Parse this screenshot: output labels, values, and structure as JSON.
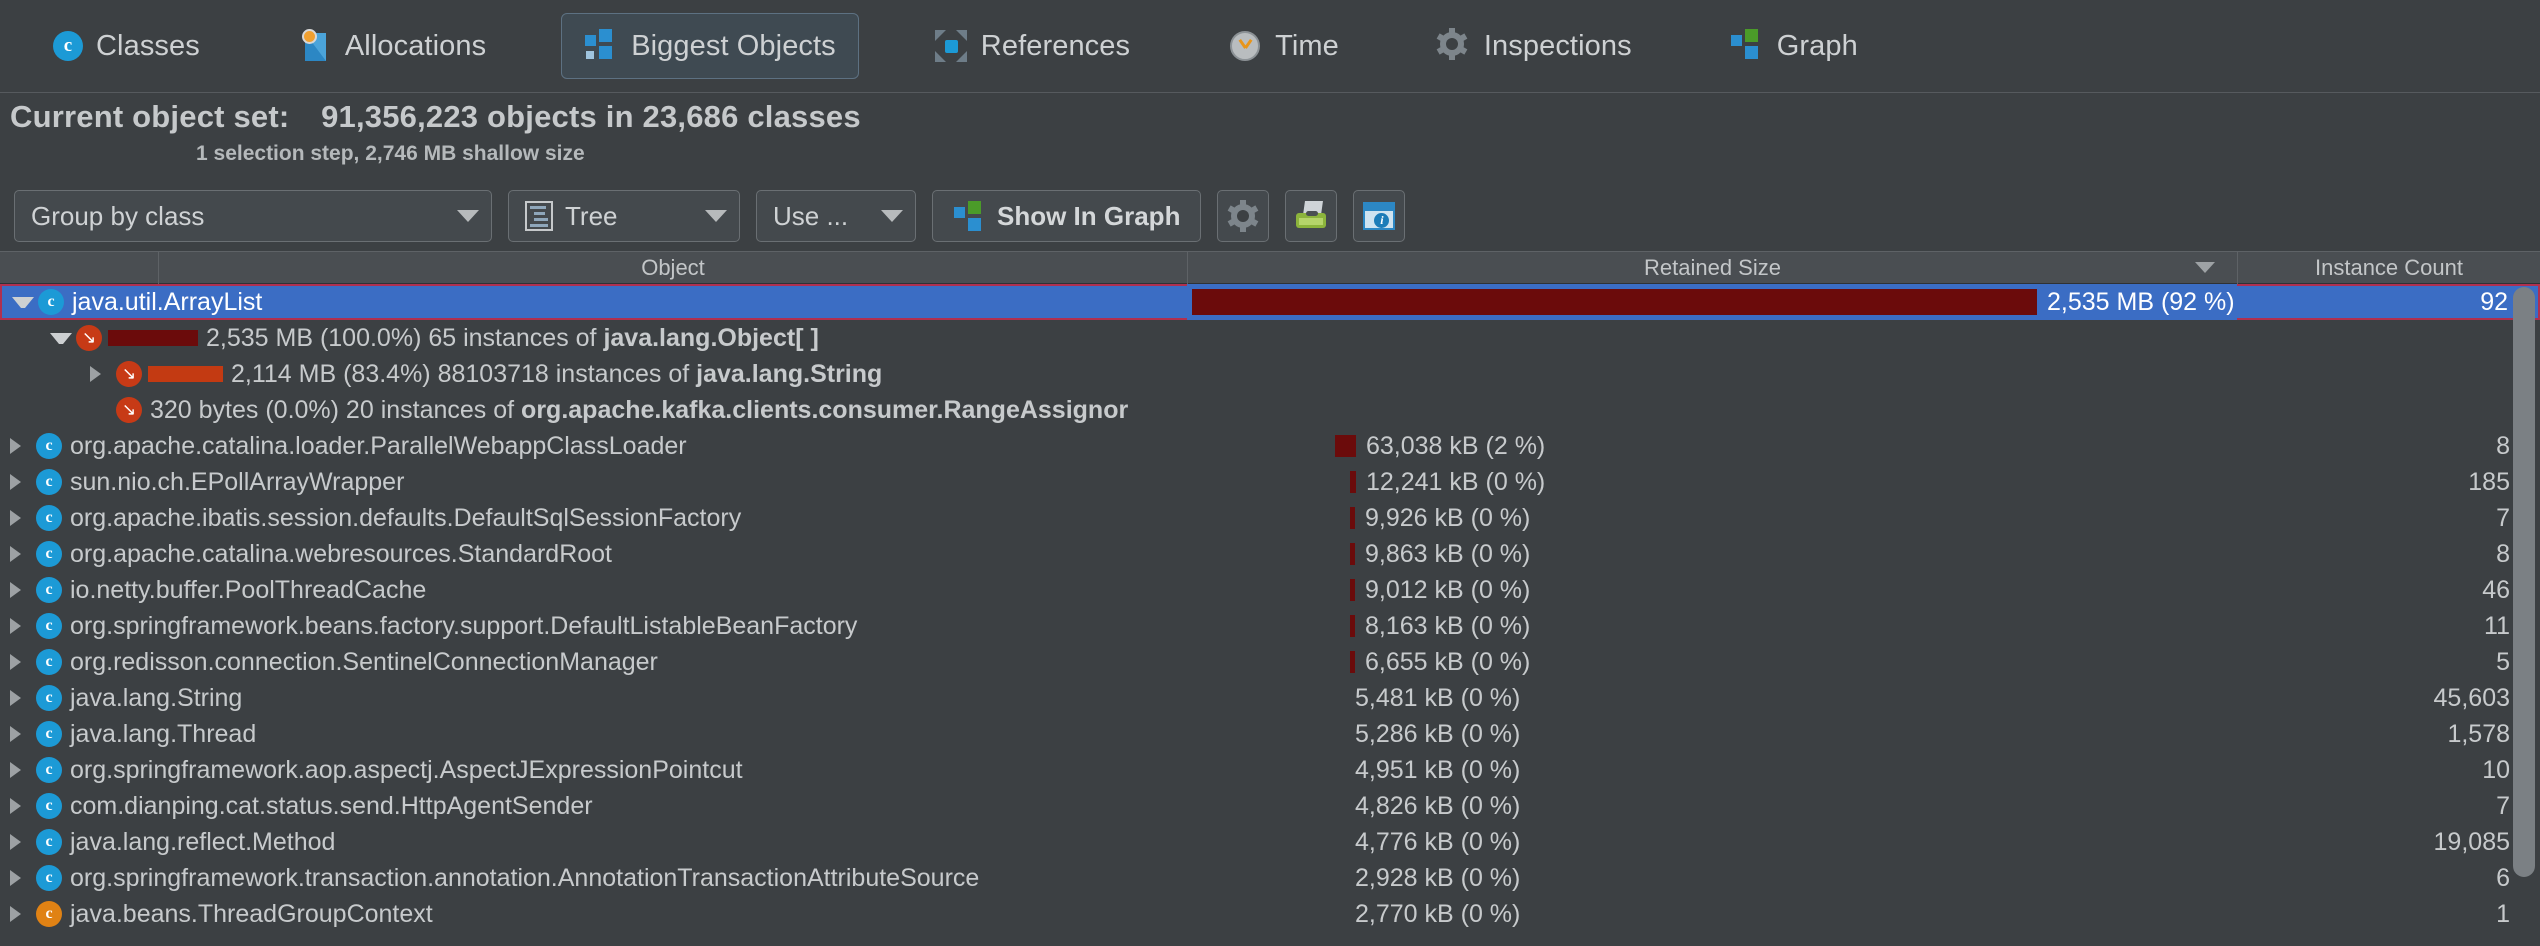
{
  "tabs": [
    {
      "label": "Classes",
      "icon": "class-circle-icon",
      "selected": false
    },
    {
      "label": "Allocations",
      "icon": "allocations-icon",
      "selected": false
    },
    {
      "label": "Biggest Objects",
      "icon": "biggest-objects-icon",
      "selected": true
    },
    {
      "label": "References",
      "icon": "references-icon",
      "selected": false
    },
    {
      "label": "Time",
      "icon": "clock-icon",
      "selected": false
    },
    {
      "label": "Inspections",
      "icon": "gear-icon",
      "selected": false
    },
    {
      "label": "Graph",
      "icon": "graph-icon",
      "selected": false
    }
  ],
  "object_set": {
    "label": "Current object set:",
    "summary": "91,356,223 objects in 23,686 classes",
    "detail": "1 selection step, 2,746 MB shallow size",
    "objects_count": "91,356,223",
    "classes_count": "23,686",
    "selection_steps": "1",
    "shallow_size": "2,746 MB"
  },
  "toolbar": {
    "group_by": "Group by class",
    "view_mode": "Tree",
    "use_menu": "Use ...",
    "show_in_graph": "Show In Graph",
    "settings_icon": "gear-icon",
    "export_icon": "typewriter-printer-icon",
    "info_icon": "info-window-icon"
  },
  "table": {
    "columns": [
      "",
      "Object",
      "Retained Size",
      "Instance Count"
    ],
    "sorted_column": "Retained Size",
    "rows": [
      {
        "kind": "class",
        "icon": "class-circle-icon",
        "icon_color": "#1c9ad6",
        "depth": 0,
        "twisty": "open",
        "selected": true,
        "name": "java.util.ArrayList",
        "retained_size": "2,535 MB (92 %)",
        "bar_pct": 92,
        "bar_color": "#6b0b0b",
        "instance_count": "92"
      },
      {
        "kind": "reference",
        "icon": "reference-arrow-icon",
        "icon_color": "#c73a16",
        "depth": 1,
        "twisty": "open",
        "selected": false,
        "name": "2,535 MB (100.0%) 65 instances of java.lang.Object[ ]",
        "size_text": "2,535 MB (100.0%)",
        "instances_text": "65 instances of",
        "class_name": "java.lang.Object[ ]",
        "mini_bar_pct": 100,
        "retained_size": "",
        "instance_count": ""
      },
      {
        "kind": "reference",
        "icon": "reference-arrow-icon",
        "icon_color": "#c73a16",
        "depth": 2,
        "twisty": "closed",
        "selected": false,
        "name": "2,114 MB (83.4%) 88103718 instances of java.lang.String",
        "size_text": "2,114 MB (83.4%)",
        "instances_text": "88103718 instances of",
        "class_name": "java.lang.String",
        "mini_bar_pct": 83.4,
        "retained_size": "",
        "instance_count": ""
      },
      {
        "kind": "reference",
        "icon": "reference-arrow-icon",
        "icon_color": "#c73a16",
        "depth": 2,
        "twisty": "none",
        "selected": false,
        "name": "320 bytes (0.0%) 20 instances of org.apache.kafka.clients.consumer.RangeAssignor",
        "size_text": "320 bytes (0.0%)",
        "instances_text": "20 instances of",
        "class_name": "org.apache.kafka.clients.consumer.RangeAssignor",
        "mini_bar_pct": 0,
        "retained_size": "",
        "instance_count": ""
      },
      {
        "kind": "class",
        "icon": "class-circle-icon",
        "icon_color": "#1c9ad6",
        "depth": 0,
        "twisty": "closed",
        "selected": false,
        "name": "org.apache.catalina.loader.ParallelWebappClassLoader",
        "retained_size": "63,038 kB (2 %)",
        "bar_pct": 2.3,
        "bar_color": "#6b0b0b",
        "instance_count": "8"
      },
      {
        "kind": "class",
        "icon": "class-circle-icon",
        "icon_color": "#1c9ad6",
        "depth": 0,
        "twisty": "closed",
        "selected": false,
        "name": "sun.nio.ch.EPollArrayWrapper",
        "retained_size": "12,241 kB (0 %)",
        "bar_pct": 0.45,
        "bar_color": "#6b0b0b",
        "instance_count": "185"
      },
      {
        "kind": "class",
        "icon": "class-circle-icon",
        "icon_color": "#1c9ad6",
        "depth": 0,
        "twisty": "closed",
        "selected": false,
        "name": "org.apache.ibatis.session.defaults.DefaultSqlSessionFactory",
        "retained_size": "9,926 kB (0 %)",
        "bar_pct": 0.36,
        "bar_color": "#6b0b0b",
        "instance_count": "7"
      },
      {
        "kind": "class",
        "icon": "class-circle-icon",
        "icon_color": "#1c9ad6",
        "depth": 0,
        "twisty": "closed",
        "selected": false,
        "name": "org.apache.catalina.webresources.StandardRoot",
        "retained_size": "9,863 kB (0 %)",
        "bar_pct": 0.36,
        "bar_color": "#6b0b0b",
        "instance_count": "8"
      },
      {
        "kind": "class",
        "icon": "class-circle-icon",
        "icon_color": "#1c9ad6",
        "depth": 0,
        "twisty": "closed",
        "selected": false,
        "name": "io.netty.buffer.PoolThreadCache",
        "retained_size": "9,012 kB (0 %)",
        "bar_pct": 0.33,
        "bar_color": "#6b0b0b",
        "instance_count": "46"
      },
      {
        "kind": "class",
        "icon": "class-circle-icon",
        "icon_color": "#1c9ad6",
        "depth": 0,
        "twisty": "closed",
        "selected": false,
        "name": "org.springframework.beans.factory.support.DefaultListableBeanFactory",
        "retained_size": "8,163 kB (0 %)",
        "bar_pct": 0.3,
        "bar_color": "#6b0b0b",
        "instance_count": "11"
      },
      {
        "kind": "class",
        "icon": "class-circle-icon",
        "icon_color": "#1c9ad6",
        "depth": 0,
        "twisty": "closed",
        "selected": false,
        "name": "org.redisson.connection.SentinelConnectionManager",
        "retained_size": "6,655 kB (0 %)",
        "bar_pct": 0.24,
        "bar_color": "#6b0b0b",
        "instance_count": "5"
      },
      {
        "kind": "class",
        "icon": "class-circle-icon",
        "icon_color": "#1c9ad6",
        "depth": 0,
        "twisty": "closed",
        "selected": false,
        "name": "java.lang.String",
        "retained_size": "5,481 kB (0 %)",
        "bar_pct": 0,
        "bar_color": "#6b0b0b",
        "instance_count": "45,603"
      },
      {
        "kind": "class",
        "icon": "class-circle-icon",
        "icon_color": "#1c9ad6",
        "depth": 0,
        "twisty": "closed",
        "selected": false,
        "name": "java.lang.Thread",
        "retained_size": "5,286 kB (0 %)",
        "bar_pct": 0,
        "bar_color": "#6b0b0b",
        "instance_count": "1,578"
      },
      {
        "kind": "class",
        "icon": "class-circle-icon",
        "icon_color": "#1c9ad6",
        "depth": 0,
        "twisty": "closed",
        "selected": false,
        "name": "org.springframework.aop.aspectj.AspectJExpressionPointcut",
        "retained_size": "4,951 kB (0 %)",
        "bar_pct": 0,
        "bar_color": "#6b0b0b",
        "instance_count": "10"
      },
      {
        "kind": "class",
        "icon": "class-circle-icon",
        "icon_color": "#1c9ad6",
        "depth": 0,
        "twisty": "closed",
        "selected": false,
        "name": "com.dianping.cat.status.send.HttpAgentSender",
        "retained_size": "4,826 kB (0 %)",
        "bar_pct": 0,
        "bar_color": "#6b0b0b",
        "instance_count": "7"
      },
      {
        "kind": "class",
        "icon": "class-circle-icon",
        "icon_color": "#1c9ad6",
        "depth": 0,
        "twisty": "closed",
        "selected": false,
        "name": "java.lang.reflect.Method",
        "retained_size": "4,776 kB (0 %)",
        "bar_pct": 0,
        "bar_color": "#6b0b0b",
        "instance_count": "19,085"
      },
      {
        "kind": "class",
        "icon": "class-circle-icon",
        "icon_color": "#1c9ad6",
        "depth": 0,
        "twisty": "closed",
        "selected": false,
        "name": "org.springframework.transaction.annotation.AnnotationTransactionAttributeSource",
        "retained_size": "2,928 kB (0 %)",
        "bar_pct": 0,
        "bar_color": "#6b0b0b",
        "instance_count": "6"
      },
      {
        "kind": "class",
        "icon": "class-circle-icon",
        "icon_color": "#e08214",
        "depth": 0,
        "twisty": "closed",
        "selected": false,
        "name": "java.beans.ThreadGroupContext",
        "retained_size": "2,770 kB (0 %)",
        "bar_pct": 0,
        "bar_color": "#6b0b0b",
        "instance_count": "1"
      }
    ]
  },
  "colors": {
    "background": "#3c4043",
    "selection": "#3b6dc4",
    "selection_border": "#b03050",
    "bar_dark_red": "#6b0b0b",
    "bar_bright_red": "#c33a12",
    "accent_blue": "#1c9ad6",
    "text": "#c7cacc"
  }
}
